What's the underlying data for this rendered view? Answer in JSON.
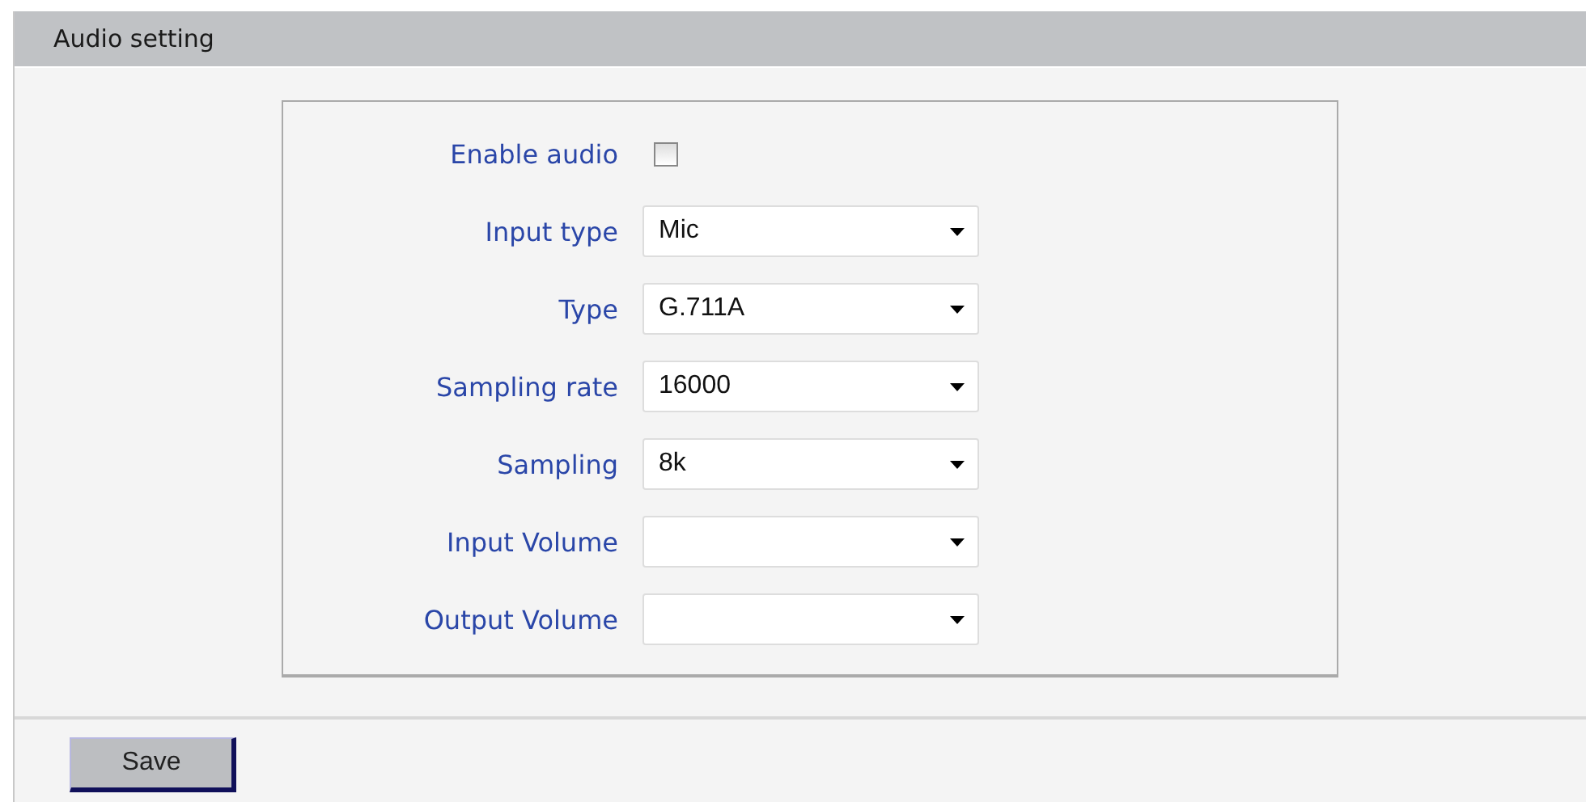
{
  "panel": {
    "title": "Audio setting"
  },
  "fields": [
    {
      "kind": "checkbox",
      "label": "Enable audio",
      "checked": false
    },
    {
      "kind": "select",
      "label": "Input type",
      "value": "Mic"
    },
    {
      "kind": "select",
      "label": "Type",
      "value": "G.711A"
    },
    {
      "kind": "select",
      "label": "Sampling rate",
      "value": "16000"
    },
    {
      "kind": "select",
      "label": "Sampling",
      "value": "8k"
    },
    {
      "kind": "select",
      "label": "Input Volume"
    },
    {
      "kind": "select",
      "label": "Output Volume"
    }
  ],
  "buttons": [
    {
      "label": "Save"
    }
  ]
}
